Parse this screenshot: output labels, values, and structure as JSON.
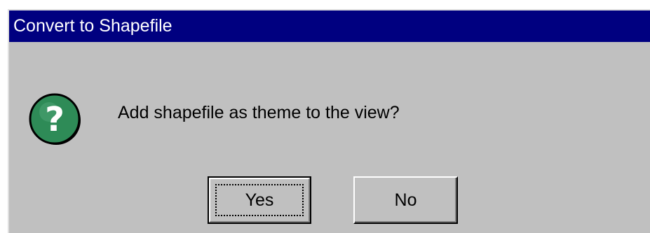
{
  "dialog": {
    "title": "Convert to Shapefile",
    "message": "Add shapefile as theme to the view?",
    "icon": "question-icon",
    "buttons": {
      "yes_label": "Yes",
      "no_label": "No"
    }
  },
  "colors": {
    "titlebar": "#000080",
    "titlebar_text": "#ffffff",
    "dialog_face": "#c0c0c0",
    "icon_fill": "#2e8b57",
    "icon_glyph": "#ffffff"
  }
}
